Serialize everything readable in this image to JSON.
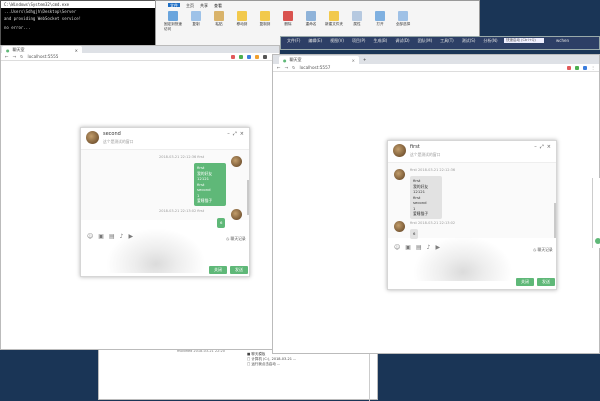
{
  "console": {
    "title": "C:\\Windows\\System32\\cmd.exe",
    "lines": [
      "...Users\\Sdhgjh\\Desktop\\Server",
      "and providing WebSocket service!",
      "",
      "no error..."
    ]
  },
  "explorer": {
    "tabs": [
      "文件",
      "主页",
      "共享",
      "查看"
    ],
    "buttons": [
      "固定到快速访问",
      "复制",
      "粘贴",
      "剪切",
      "复制路径",
      "粘贴快捷方式",
      "移动到",
      "复制到",
      "删除",
      "重命名",
      "新建文件夹",
      "新建项目",
      "轻松访问",
      "属性",
      "打开",
      "编辑",
      "历史记录",
      "全部选择",
      "全部取消",
      "反向选择"
    ],
    "sections": [
      "剪贴板",
      "组织",
      "新建",
      "打开",
      "选择"
    ]
  },
  "vs": {
    "menu": [
      "文件(F)",
      "编辑(E)",
      "视图(V)",
      "项目(P)",
      "生成(B)",
      "调试(D)",
      "团队(M)",
      "工具(T)",
      "测试(S)",
      "分析(N)",
      "窗口(W)",
      "帮助(H)"
    ],
    "search": "快速启动 (Ctrl+Q)",
    "user": "wchen"
  },
  "left_browser": {
    "url": "localhost:5555",
    "tab": "聊天室"
  },
  "right_browser": {
    "tab": "聊天室",
    "url": "localhost:5557"
  },
  "chat_left": {
    "name": "second",
    "subtitle": "这个是测试的窗口",
    "meta": "2018-03-21 22:12:36 first",
    "bubble_lines": [
      "first",
      "我的好友12121",
      "first",
      "second",
      "1",
      "爱睡猫子"
    ],
    "meta2": "2018-03-21 22:13:02 first",
    "bubble2": "6",
    "record": "聊天记录",
    "close": "关闭",
    "send": "发送"
  },
  "chat_right": {
    "name": "first",
    "subtitle": "这个是测试的窗口",
    "meta": "first  2018-03-21 22:12:36",
    "bubble_lines": [
      "first",
      "我的好友12121",
      "first",
      "second",
      "1",
      "爱睡猫子"
    ],
    "meta2": "first  2018-03-21 22:13:02",
    "bubble2": "6",
    "record": "聊天记录",
    "close": "关闭",
    "send": "发送"
  },
  "background": {
    "items": [
      "□ 已连接成功",
      "需要的用户",
      "■ 聊天模板",
      "□ 计算机 (C:), 2018-03-21 ...",
      "□ 运行我点击启动  ..."
    ],
    "stamp": "modified  2018-03-21 22:20"
  },
  "colors": {
    "accent": "#5fb878",
    "desktop": "#1a3556",
    "vs": "#2d3f66"
  }
}
